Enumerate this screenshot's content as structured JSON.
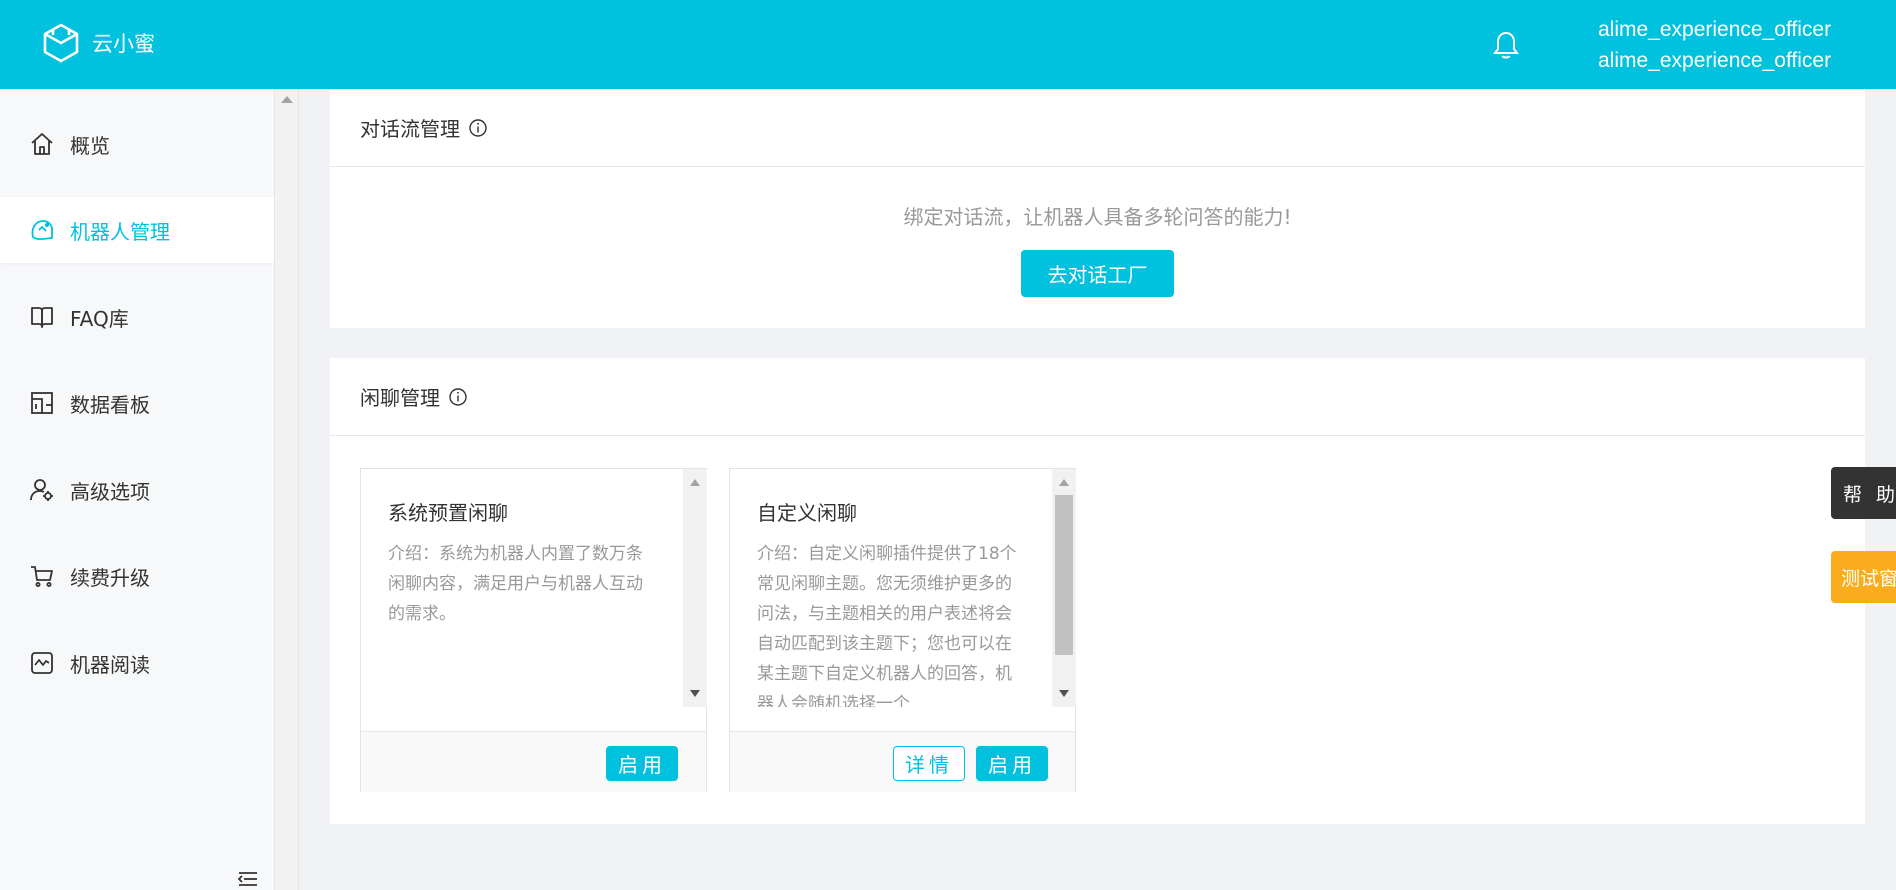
{
  "header": {
    "app_name": "云小蜜",
    "user_line1": "alime_experience_officer",
    "user_line2": "alime_experience_officer"
  },
  "sidebar": {
    "items": [
      {
        "label": "概览",
        "icon": "home-icon",
        "active": false
      },
      {
        "label": "机器人管理",
        "icon": "robot-icon",
        "active": true
      },
      {
        "label": "FAQ库",
        "icon": "book-icon",
        "active": false
      },
      {
        "label": "数据看板",
        "icon": "dashboard-icon",
        "active": false
      },
      {
        "label": "高级选项",
        "icon": "user-settings-icon",
        "active": false
      },
      {
        "label": "续费升级",
        "icon": "cart-icon",
        "active": false
      },
      {
        "label": "机器阅读",
        "icon": "reading-chart-icon",
        "active": false
      }
    ]
  },
  "dialog_flow": {
    "title": "对话流管理",
    "empty_text": "绑定对话流，让机器人具备多轮问答的能力!",
    "button": "去对话工厂"
  },
  "chitchat": {
    "title": "闲聊管理",
    "cards": [
      {
        "title": "系统预置闲聊",
        "desc": "介绍：系统为机器人内置了数万条闲聊内容，满足用户与机器人互动的需求。",
        "enable": "启用"
      },
      {
        "title": "自定义闲聊",
        "desc": "介绍：自定义闲聊插件提供了18个常见闲聊主题。您无须维护更多的问法，与主题相关的用户表述将会自动匹配到该主题下；您也可以在某主题下自定义机器人的回答，机器人会随机选择一个",
        "detail": "详情",
        "enable": "启用"
      }
    ]
  },
  "floating": {
    "help": "帮助",
    "test": "测试窗"
  },
  "colors": {
    "brand": "#00c1de",
    "warning": "#f9ad1c"
  }
}
